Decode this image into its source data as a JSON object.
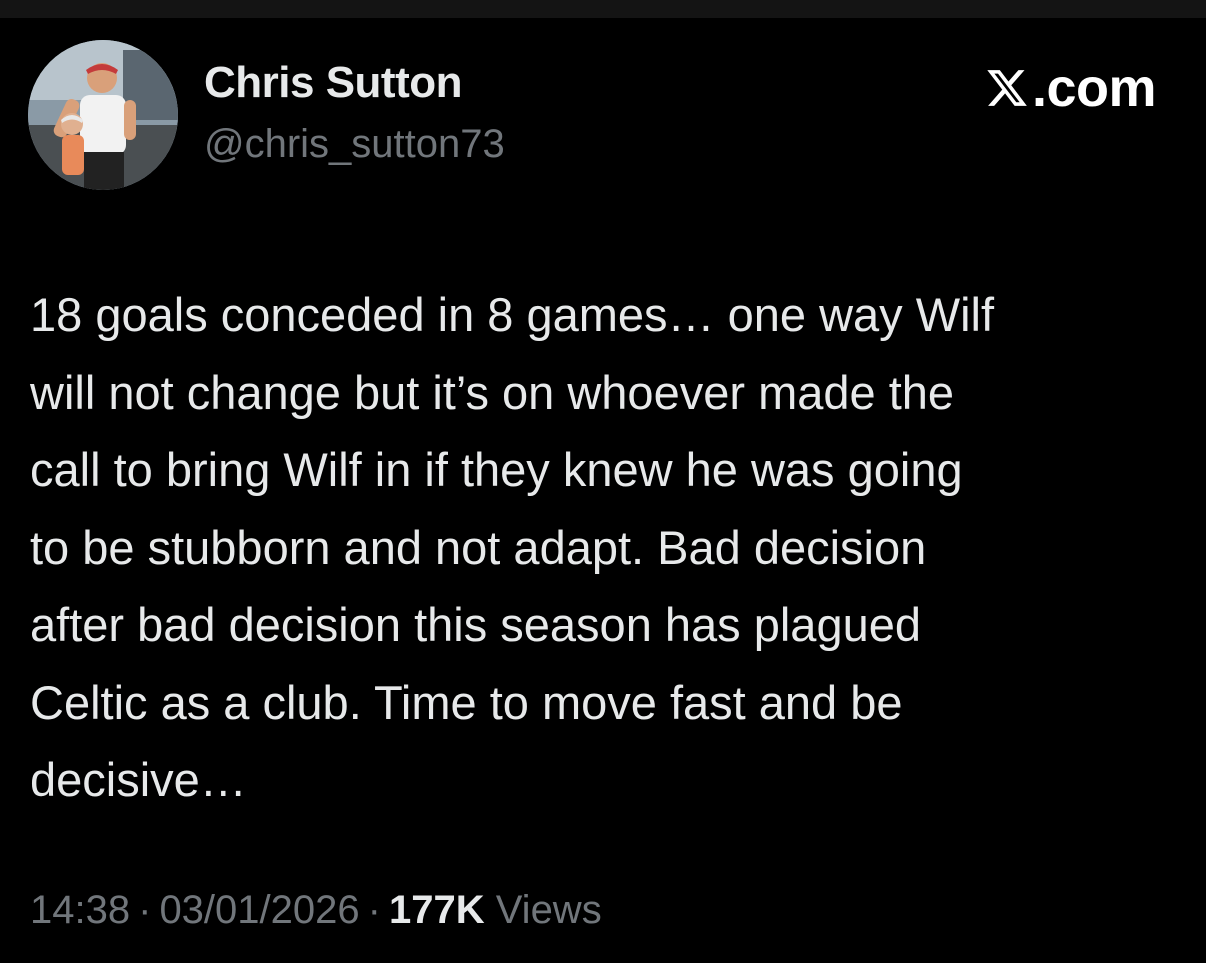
{
  "author": {
    "display_name": "Chris Sutton",
    "handle": "@chris_sutton73",
    "avatar_icon": "profile-photo"
  },
  "brand": {
    "icon": "x-logo-icon",
    "text": ".com"
  },
  "tweet": {
    "lines": [
      "18 goals conceded in 8 games… one way Wilf",
      "will not change but it’s on whoever made the",
      "call to bring Wilf in if they knew he was going",
      "to be stubborn and not adapt. Bad decision",
      "after bad decision this season has plagued",
      "Celtic as a club. Time to move fast and be",
      "decisive…"
    ]
  },
  "meta": {
    "time": "14:38",
    "separator": "·",
    "date": "03/01/2026",
    "views_count": "177K",
    "views_label": "Views"
  },
  "colors": {
    "background": "#000000",
    "primary_text": "#e7e9ea",
    "secondary_text": "#71767b"
  }
}
